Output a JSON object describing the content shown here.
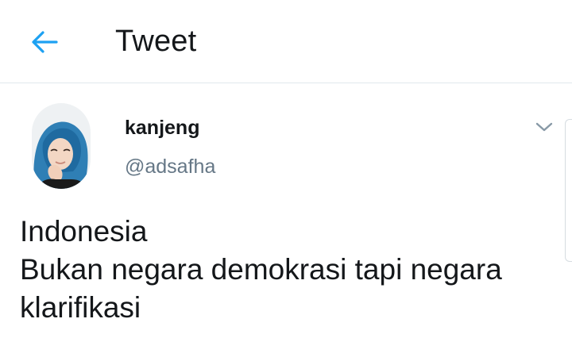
{
  "header": {
    "title": "Tweet",
    "back_icon": "arrow-left-icon",
    "accent_color": "#1da1f2"
  },
  "tweet": {
    "display_name": "kanjeng",
    "handle": "@adsafha",
    "avatar_icon": "avatar-photo",
    "menu_icon": "chevron-down-icon",
    "text_lines": [
      "Indonesia",
      "Bukan negara demokrasi tapi negara",
      "klarifikasi"
    ]
  },
  "colors": {
    "text_primary": "#14171a",
    "text_secondary": "#657786",
    "divider": "#e1e8ed"
  }
}
